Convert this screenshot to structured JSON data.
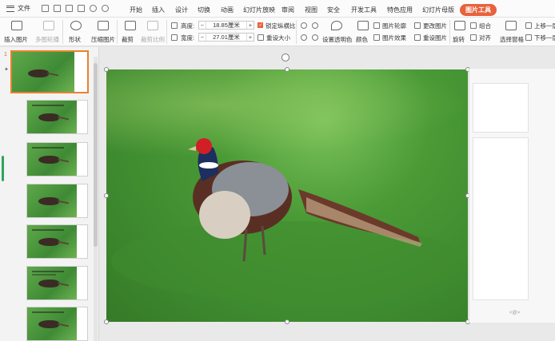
{
  "menubar": {
    "file_label": "文件",
    "tabs": [
      "开始",
      "插入",
      "设计",
      "切换",
      "动画",
      "幻灯片放映",
      "审阅",
      "视图",
      "安全",
      "开发工具",
      "特色应用",
      "幻灯片母版",
      "图片工具"
    ],
    "active_tab": "图片工具"
  },
  "ribbon": {
    "insert_picture": "插入图片",
    "multi_picture": "多图轮播",
    "shape": "形状",
    "compress": "压缩图片",
    "crop": "裁剪",
    "crop_ratio": "裁剪比例",
    "height_label": "高度:",
    "height_value": "18.85厘米",
    "width_label": "宽度:",
    "width_value": "27.01厘米",
    "lock_ratio": "锁定纵横比",
    "reset_size": "重设大小",
    "transparent": "设置透明色",
    "color": "颜色",
    "outline": "图片轮廓",
    "effect": "图片效果",
    "change_picture": "更改图片",
    "reset_picture": "重设图片",
    "rotate": "旋转",
    "group": "组合",
    "align": "对齐",
    "select_pane": "选择窗格",
    "bring_forward": "上移一层",
    "send_backward": "下移一层"
  },
  "panel": {
    "slide_number": "1"
  },
  "pane": {
    "footer": "<@>"
  },
  "colors": {
    "accent": "#e8623d",
    "selected_thumb": "#e8822d",
    "scroll_marker": "#2fa35d"
  }
}
